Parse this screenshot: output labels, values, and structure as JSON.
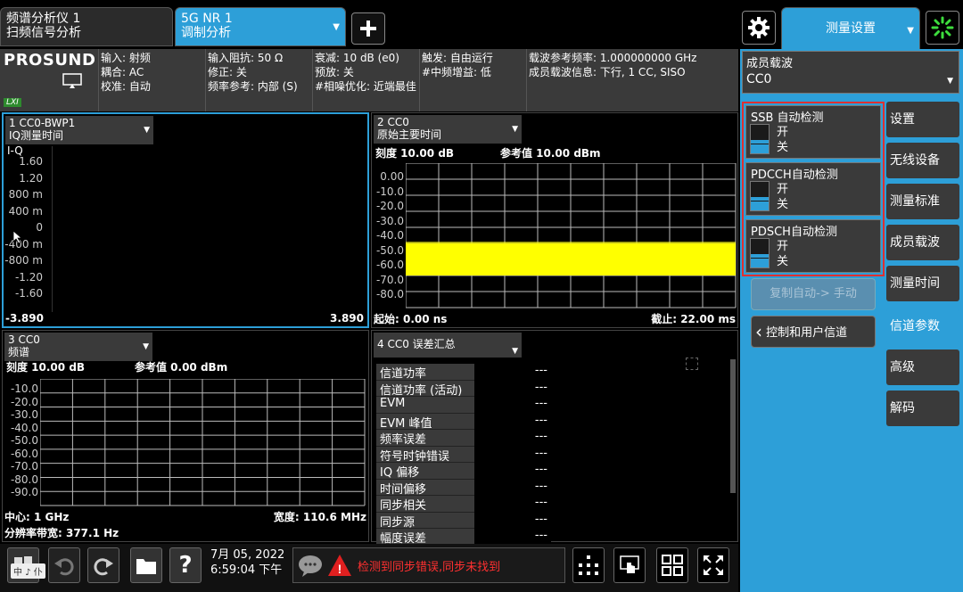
{
  "tabs": [
    {
      "line1": "频谱分析仪 1",
      "line2": "扫频信号分析"
    },
    {
      "line1": "5G NR 1",
      "line2": "调制分析"
    }
  ],
  "top_right": {
    "menu_label": "测量设置"
  },
  "logo": "PROSUND",
  "lxi": "LXI",
  "info": {
    "c1": [
      "输入: 射频",
      "耦合: AC",
      "校准: 自动"
    ],
    "c2": [
      "输入阻抗: 50 Ω",
      "修正: 关",
      "频率参考: 内部 (S)"
    ],
    "c3": [
      "衰减: 10 dB (e0)",
      "预放: 关",
      "#相噪优化: 近端最佳"
    ],
    "c4": [
      "触发: 自由运行",
      "#中频增益: 低"
    ],
    "c5": [
      "载波参考频率: 1.000000000 GHz",
      "成员载波信息: 下行, 1 CC, SISO"
    ]
  },
  "win1": {
    "title1": "1 CC0-BWP1",
    "title2": "IQ测量时间",
    "label": "I-Q",
    "yticks": [
      "1.60",
      "1.20",
      "800 m",
      "400 m",
      "0",
      "-400 m",
      "-800 m",
      "-1.20",
      "-1.60"
    ],
    "xmin": "-3.890",
    "xmax": "3.890"
  },
  "win2": {
    "title1": "2 CC0",
    "title2": "原始主要时间",
    "scale": "刻度 10.00 dB",
    "ref": "参考值 10.00 dBm",
    "yticks": [
      "0.00",
      "-10.0",
      "-20.0",
      "-30.0",
      "-40.0",
      "-50.0",
      "-60.0",
      "-70.0",
      "-80.0"
    ],
    "start": "起始: 0.00 ns",
    "stop": "截止: 22.00 ms",
    "trace_color": "#ffff00"
  },
  "win3": {
    "title1": "3 CC0",
    "title2": "频谱",
    "scale": "刻度 10.00 dB",
    "ref": "参考值 0.00 dBm",
    "yticks": [
      "-10.0",
      "-20.0",
      "-30.0",
      "-40.0",
      "-50.0",
      "-60.0",
      "-70.0",
      "-80.0",
      "-90.0"
    ],
    "center": "中心: 1 GHz",
    "span": "宽度: 110.6 MHz",
    "rbw": "分辨率带宽: 377.1 Hz"
  },
  "win4": {
    "title": "4 CC0 误差汇总",
    "rows": [
      {
        "k": "信道功率",
        "v": "---"
      },
      {
        "k": "信道功率 (活动)",
        "v": "---"
      },
      {
        "k": "EVM",
        "v": "---"
      },
      {
        "k": "EVM 峰值",
        "v": "---"
      },
      {
        "k": "频率误差",
        "v": "---"
      },
      {
        "k": "符号时钟错误",
        "v": "---"
      },
      {
        "k": "IQ 偏移",
        "v": "---"
      },
      {
        "k": "时间偏移",
        "v": "---"
      },
      {
        "k": "同步相关",
        "v": "---"
      },
      {
        "k": "同步源",
        "v": "---"
      },
      {
        "k": "幅度误差",
        "v": "---"
      }
    ]
  },
  "panel": {
    "cc_label": "成员载波",
    "cc_value": "CC0",
    "toggles": [
      {
        "title": "SSB 自动检测",
        "on": "开",
        "off": "关"
      },
      {
        "title": "PDCCH自动检测",
        "on": "开",
        "off": "关"
      },
      {
        "title": "PDSCH自动检测",
        "on": "开",
        "off": "关"
      }
    ],
    "copy_btn": "复制自动-> 手动",
    "ctrl_btn": "控制和用户信道"
  },
  "side": [
    "设置",
    "无线设备",
    "测量标准",
    "成员载波",
    "测量时间",
    "信道参数",
    "高级",
    "解码"
  ],
  "taskbar": {
    "ime": "中 ♪ 仆",
    "date": "7月 05, 2022",
    "time": "6:59:04 下午",
    "message": "检测到同步错误,同步未找到"
  }
}
